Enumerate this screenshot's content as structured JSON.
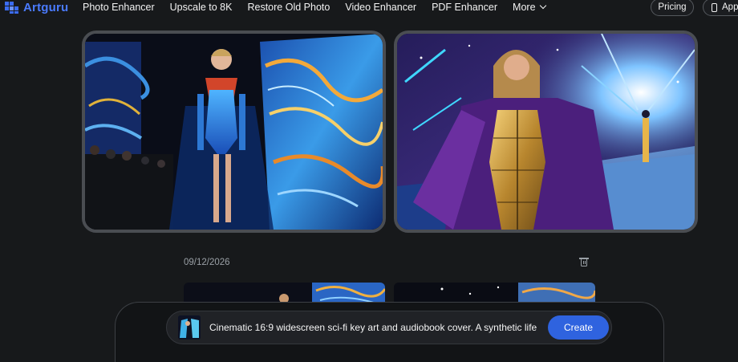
{
  "brand": {
    "name": "Artguru"
  },
  "nav": {
    "links": [
      "Photo Enhancer",
      "Upscale to 8K",
      "Restore Old Photo",
      "Video Enhancer",
      "PDF Enhancer"
    ],
    "more_label": "More",
    "pricing_label": "Pricing",
    "app_label": "App"
  },
  "gallery": {
    "date": "09/12/2026"
  },
  "prompt": {
    "text": "Cinematic 16:9 widescreen sci-fi key art and audiobook cover. A synthetic life",
    "create_label": "Create"
  },
  "colors": {
    "background": "#17191b",
    "brand_blue": "#4a7bff",
    "create_button": "#2f63df",
    "card_border": "#4a4d52"
  },
  "icons": [
    "artguru-logo-icon",
    "chevron-down-icon",
    "phone-icon",
    "trash-icon"
  ]
}
